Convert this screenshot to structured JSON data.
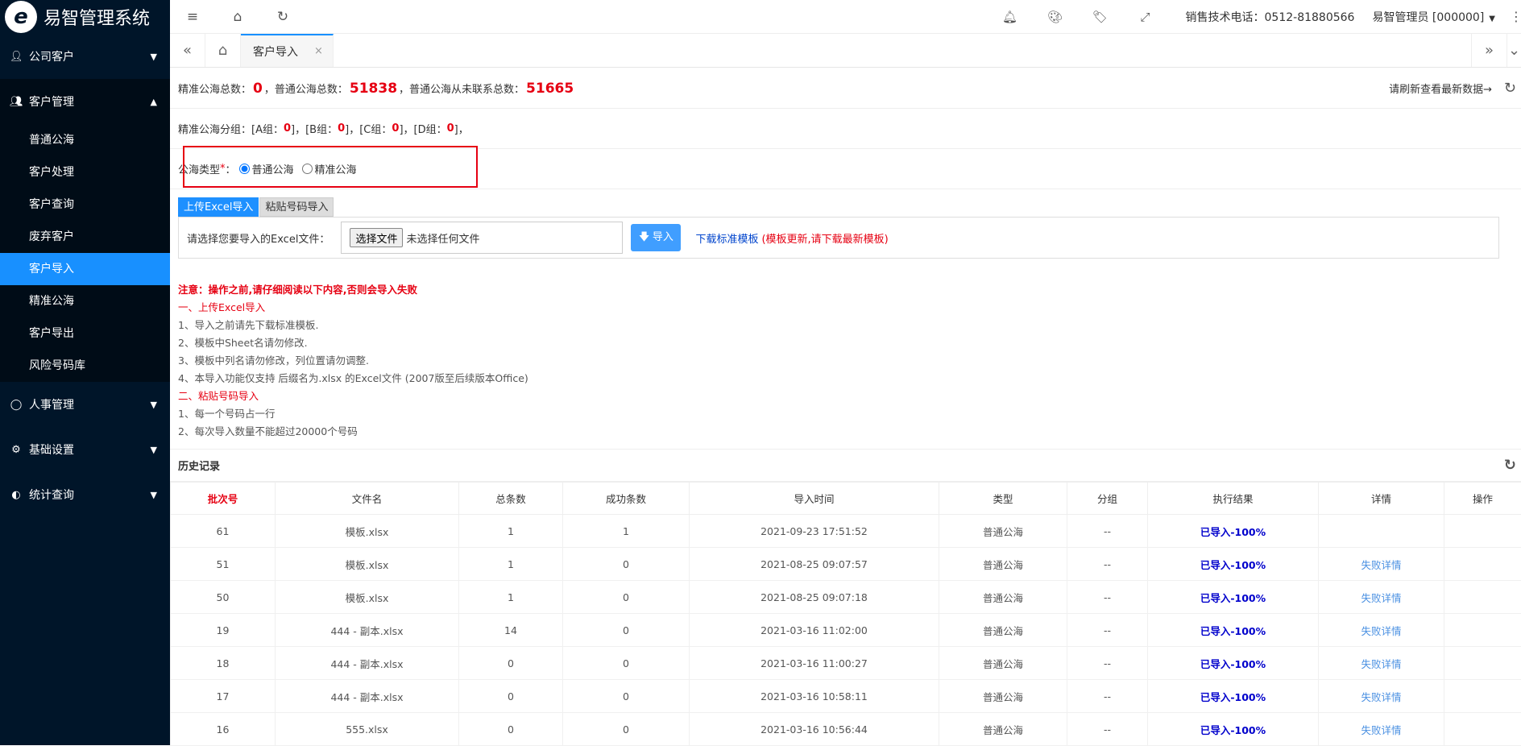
{
  "app": {
    "name": "易智管理系统",
    "logo_glyph": "e"
  },
  "sidebar": {
    "groups": [
      {
        "label": "公司客户",
        "icon": "user-icon"
      },
      {
        "label": "客户管理",
        "icon": "users-icon"
      },
      {
        "label": "人事管理",
        "icon": "person-icon"
      },
      {
        "label": "基础设置",
        "icon": "gear-icon"
      },
      {
        "label": "统计查询",
        "icon": "chart-icon"
      }
    ],
    "sub_items": [
      "普通公海",
      "客户处理",
      "客户查询",
      "废弃客户",
      "客户导入",
      "精准公海",
      "客户导出",
      "风险号码库"
    ],
    "active_sub": "客户导入"
  },
  "topbar": {
    "phone": "销售技术电话：0512-81880566",
    "admin": "易智管理员 [000000]",
    "icons": [
      "menu-fold-icon",
      "home-icon",
      "refresh-icon",
      "bell-icon",
      "palette-icon",
      "tag-icon",
      "fullscreen-icon"
    ]
  },
  "tabs": {
    "open": [
      {
        "label": "客户导入"
      }
    ]
  },
  "summary": {
    "label1": "精准公海总数：",
    "v1": "0",
    "label2": "，普通公海总数：",
    "v2": "51838",
    "label3": "，普通公海从未联系总数：",
    "v3": "51665",
    "refresh_hint": "请刷新查看最新数据→"
  },
  "groups": {
    "prefix": "精准公海分组：",
    "items": [
      {
        "label": "[A组：",
        "value": "0"
      },
      {
        "label": "[B组：",
        "value": "0"
      },
      {
        "label": "[C组：",
        "value": "0"
      },
      {
        "label": "[D组：",
        "value": "0"
      }
    ],
    "suffix": "]，"
  },
  "sea_type": {
    "label": "公海类型",
    "required": "*",
    "colon": "：",
    "options": [
      "普通公海",
      "精准公海"
    ],
    "selected": "普通公海"
  },
  "import": {
    "tabs": [
      "上传Excel导入",
      "粘贴号码导入"
    ],
    "active_tab": "上传Excel导入",
    "file_label": "请选择您要导入的Excel文件：",
    "choose_button": "选择文件",
    "no_file": "未选择任何文件",
    "import_button": "导入",
    "template_link": "下载标准模板",
    "template_note": "(模板更新,请下载最新模板)"
  },
  "notes": {
    "warning": "注意：操作之前,请仔细阅读以下内容,否则会导入失败",
    "section1": "一、上传Excel导入",
    "s1_items": [
      "1、导入之前请先下载标准模板.",
      "2、模板中Sheet名请勿修改.",
      "3、模板中列名请勿修改，列位置请勿调整.",
      "4、本导入功能仅支持 后缀名为.xlsx 的Excel文件 (2007版至后续版本Office)"
    ],
    "section2": "二、粘贴号码导入",
    "s2_items": [
      "1、每一个号码占一行",
      "2、每次导入数量不能超过20000个号码"
    ]
  },
  "history": {
    "title": "历史记录",
    "columns": [
      "批次号",
      "文件名",
      "总条数",
      "成功条数",
      "导入时间",
      "类型",
      "分组",
      "执行结果",
      "详情",
      "操作"
    ],
    "rows": [
      {
        "batch": "61",
        "file": "模板.xlsx",
        "total": "1",
        "success": "1",
        "time": "2021-09-23 17:51:52",
        "type": "普通公海",
        "group": "--",
        "result": "已导入-100%",
        "detail": ""
      },
      {
        "batch": "51",
        "file": "模板.xlsx",
        "total": "1",
        "success": "0",
        "time": "2021-08-25 09:07:57",
        "type": "普通公海",
        "group": "--",
        "result": "已导入-100%",
        "detail": "失败详情"
      },
      {
        "batch": "50",
        "file": "模板.xlsx",
        "total": "1",
        "success": "0",
        "time": "2021-08-25 09:07:18",
        "type": "普通公海",
        "group": "--",
        "result": "已导入-100%",
        "detail": "失败详情"
      },
      {
        "batch": "19",
        "file": "444 - 副本.xlsx",
        "total": "14",
        "success": "0",
        "time": "2021-03-16 11:02:00",
        "type": "普通公海",
        "group": "--",
        "result": "已导入-100%",
        "detail": "失败详情"
      },
      {
        "batch": "18",
        "file": "444 - 副本.xlsx",
        "total": "0",
        "success": "0",
        "time": "2021-03-16 11:00:27",
        "type": "普通公海",
        "group": "--",
        "result": "已导入-100%",
        "detail": "失败详情"
      },
      {
        "batch": "17",
        "file": "444 - 副本.xlsx",
        "total": "0",
        "success": "0",
        "time": "2021-03-16 10:58:11",
        "type": "普通公海",
        "group": "--",
        "result": "已导入-100%",
        "detail": "失败详情"
      },
      {
        "batch": "16",
        "file": "555.xlsx",
        "total": "0",
        "success": "0",
        "time": "2021-03-16 10:56:44",
        "type": "普通公海",
        "group": "--",
        "result": "已导入-100%",
        "detail": "失败详情"
      }
    ]
  }
}
